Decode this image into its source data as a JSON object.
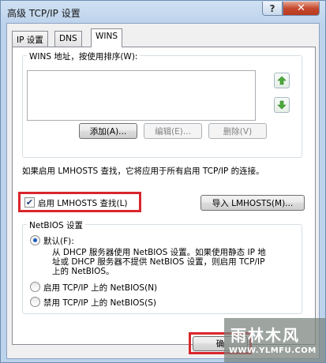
{
  "window": {
    "title": "高级 TCP/IP 设置",
    "help_label": "?",
    "close_label": "✕"
  },
  "tabs": [
    {
      "label": "IP 设置",
      "active": false
    },
    {
      "label": "DNS",
      "active": false
    },
    {
      "label": "WINS",
      "active": true
    }
  ],
  "wins": {
    "group_label": "WINS 地址，按使用排序(W):",
    "up_icon": "up-arrow-icon",
    "down_icon": "down-arrow-icon",
    "add_label": "添加(A)...",
    "edit_label": "编辑(E)...",
    "delete_label": "删除(V)"
  },
  "lmhosts": {
    "info_text": "如果启用 LMHOSTS 查找，它将应用于所有启用 TCP/IP 的连接。",
    "enable_label": "启用 LMHOSTS 查找(L)",
    "enable_checked": true,
    "import_label": "导入 LMHOSTS(M)..."
  },
  "netbios": {
    "group_label": "NetBIOS 设置",
    "options": [
      {
        "label": "默认(F):",
        "selected": true
      },
      {
        "label": "启用 TCP/IP 上的 NetBIOS(N)",
        "selected": false
      },
      {
        "label": "禁用 TCP/IP 上的 NetBIOS(S)",
        "selected": false
      }
    ],
    "default_desc_1": "从 DHCP 服务器使用 NetBIOS 设置。如果使用静态 IP 地",
    "default_desc_2": "址或 DHCP 服务器不提供 NetBIOS 设置，则启用 TCP/IP",
    "default_desc_3": "上的 NetBIOS。"
  },
  "footer": {
    "ok_label": "确"
  },
  "watermark": {
    "brand": "雨林木风",
    "url": "WWW.YLMFU.COM"
  },
  "colors": {
    "highlight": "#d9262c",
    "accent": "#1c5bbf"
  }
}
